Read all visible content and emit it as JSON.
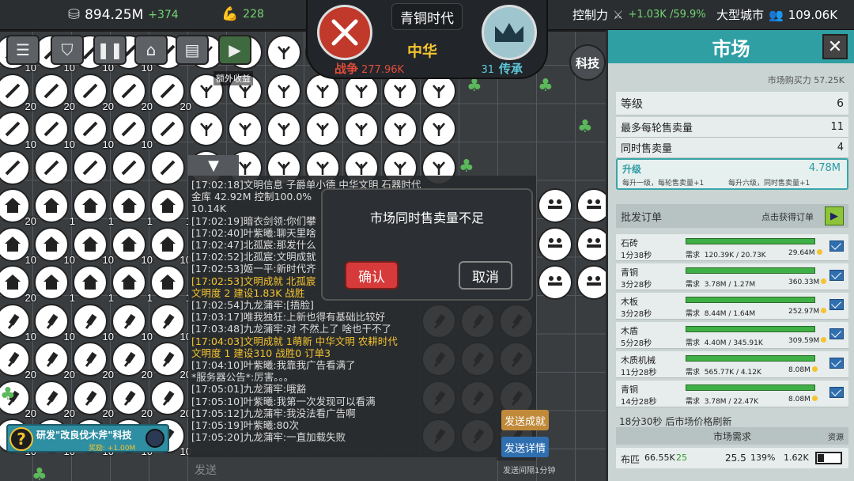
{
  "top": {
    "coins": "894.25M",
    "coins_delta": "+374",
    "strength": "228",
    "control_label": "控制力",
    "control_value": "+1.03K /59.9%",
    "city_type": "大型城市",
    "population": "109.06K"
  },
  "emblem": {
    "era": "青铜时代",
    "civilization": "中华",
    "war_label": "战争",
    "war_value": "277.96K",
    "heritage_label": "传承",
    "heritage_value": "31"
  },
  "toolbar": {
    "extra_income": "额外收益",
    "tech": "科技"
  },
  "chat": {
    "lines": [
      {
        "t": "[17:02:18]文明信息  子爵单小德  中华文明  石器时代",
        "c": ""
      },
      {
        "t": "金库 42.92M 控制100.0%",
        "c": ""
      },
      {
        "t": "10.14K",
        "c": ""
      },
      {
        "t": "[17:02:19]暗衣剑领:你们攀",
        "c": ""
      },
      {
        "t": "[17:02:40]叶紫曦:聊天里啥",
        "c": ""
      },
      {
        "t": "[17:02:47]北孤宸:那发什么",
        "c": ""
      },
      {
        "t": "[17:02:52]北孤宸:文明成就",
        "c": ""
      },
      {
        "t": "[17:02:53]姬一平:新时代齐",
        "c": ""
      },
      {
        "t": "[17:02:53]文明成就  北孤宸",
        "c": "y"
      },
      {
        "t": "     文明度 2 建设1.83K 战胜",
        "c": "y"
      },
      {
        "t": "[17:02:54]九龙蒲牢:[捂脸]",
        "c": ""
      },
      {
        "t": "[17:03:17]唯我独狂:上新也得有基础比较好",
        "c": ""
      },
      {
        "t": "[17:03:48]九龙蒲牢:对 不然上了 啥也干不了",
        "c": ""
      },
      {
        "t": "[17:04:03]文明成就  1萌新  中华文明  农耕时代",
        "c": "y"
      },
      {
        "t": "文明度 1 建设310 战胜0 订单3",
        "c": "y"
      },
      {
        "t": "[17:04:10]叶紫曦:我靠我广告看满了",
        "c": ""
      },
      {
        "t": "*服务器公告*:厉害。。。",
        "c": ""
      },
      {
        "t": "[17:05:01]九龙蒲牢:哦豁",
        "c": ""
      },
      {
        "t": "[17:05:10]叶紫曦:我第一次发现可以看满",
        "c": ""
      },
      {
        "t": "[17:05:12]九龙蒲牢:我没法看广告啊",
        "c": ""
      },
      {
        "t": "[17:05:19]叶紫曦:80次",
        "c": ""
      },
      {
        "t": "[17:05:20]九龙蒲牢:一直加载失败",
        "c": ""
      }
    ],
    "input_placeholder": "发送",
    "send_achievement": "发送成就",
    "send_detail": "发送详情",
    "send_interval": "发送间隔1分钟"
  },
  "dialog": {
    "message": "市场同时售卖量不足",
    "confirm": "确认",
    "cancel": "取消"
  },
  "research": {
    "title": "研发\"改良伐木斧\"科技",
    "reward": "奖励: +1.00M"
  },
  "market": {
    "title": "市场",
    "close": "✕",
    "purchasing_power": "市场购买力 57.25K",
    "rows": [
      {
        "label": "等级",
        "value": "6"
      },
      {
        "label": "最多每轮售卖量",
        "value": "11"
      },
      {
        "label": "同时售卖量",
        "value": "4"
      }
    ],
    "upgrade": {
      "title": "升级",
      "cost": "4.78M",
      "desc1": "每升一级，每轮售卖量+1",
      "desc2": "每升六级，同时售卖量+1"
    },
    "bulk_title": "批发订单",
    "bulk_hint": "点击获得订单",
    "demand_label": "需求",
    "orders": [
      {
        "name": "石砖",
        "time": "1分38秒",
        "need": "120.39K",
        "have": "20.73K",
        "reward": "29.64M"
      },
      {
        "name": "青铜",
        "time": "3分28秒",
        "need": "3.78M",
        "have": "1.27M",
        "reward": "360.33M"
      },
      {
        "name": "木板",
        "time": "3分28秒",
        "need": "8.44M",
        "have": "1.64M",
        "reward": "252.97M"
      },
      {
        "name": "木盾",
        "time": "5分28秒",
        "need": "4.40M",
        "have": "345.91K",
        "reward": "309.59M"
      },
      {
        "name": "木质机械",
        "time": "11分28秒",
        "need": "565.77K",
        "have": "4.12K",
        "reward": "8.08M"
      },
      {
        "name": "青铜",
        "time": "14分28秒",
        "need": "3.78M",
        "have": "22.47K",
        "reward": "8.08M"
      }
    ],
    "refresh": "18分30秒 后市场价格刷新",
    "demand_title": "市场需求",
    "demand_resource": "资源",
    "demand_row": {
      "name": "布匹",
      "amount": "66.55K",
      "count": "25",
      "price": "25.5",
      "percent": "139%",
      "stock": "1.62K"
    }
  },
  "colors": {
    "accent": "#2f9fa4",
    "gold": "#f4c430",
    "war": "#e34b3b",
    "green": "#72d672"
  }
}
